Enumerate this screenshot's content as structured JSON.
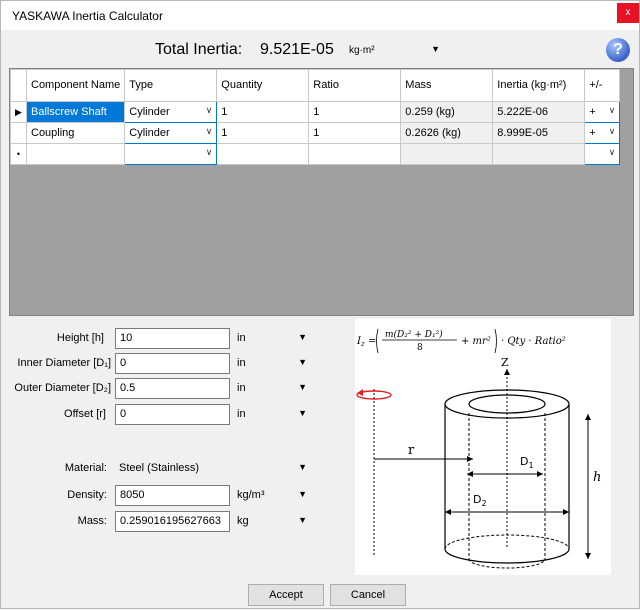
{
  "window": {
    "title": "YASKAWA Inertia Calculator",
    "close_glyph": "x"
  },
  "total": {
    "label": "Total Inertia:",
    "value": "9.521E-05",
    "unit": "kg·m²"
  },
  "grid": {
    "columns": [
      "Component Name",
      "Type",
      "Quantity",
      "Ratio",
      "Mass",
      "Inertia (kg·m²)",
      "+/-"
    ],
    "rows": [
      {
        "name": "Ballscrew Shaft",
        "type": "Cylinder",
        "quantity": "1",
        "ratio": "1",
        "mass": "0.259 (kg)",
        "inertia": "5.222E-06",
        "sign": "+"
      },
      {
        "name": "Coupling",
        "type": "Cylinder",
        "quantity": "1",
        "ratio": "1",
        "mass": "0.2626 (kg)",
        "inertia": "8.999E-05",
        "sign": "+"
      }
    ],
    "new_row_marker": "•",
    "current_row_marker": "▶"
  },
  "props": {
    "height": {
      "label": "Height [h]",
      "value": "10",
      "unit": "in"
    },
    "inner": {
      "label": "Inner Diameter [D₁]",
      "value": "0",
      "unit": "in"
    },
    "outer": {
      "label": "Outer Diameter [D₂]",
      "value": "0.5",
      "unit": "in"
    },
    "offset": {
      "label": "Offset [r]",
      "value": "0",
      "unit": "in"
    },
    "material": {
      "label": "Material:",
      "value": "Steel (Stainless)"
    },
    "density": {
      "label": "Density:",
      "value": "8050",
      "unit": "kg/m³"
    },
    "mass": {
      "label": "Mass:",
      "value": "0.259016195627663",
      "unit": "kg"
    }
  },
  "diagram": {
    "formula_lhs": "I",
    "formula_sub": "z",
    "formula_tail": "· Qty · Ratio²",
    "axis_label": "Z",
    "r_label": "r",
    "d1_label": "D",
    "d1_sub": "1",
    "d2_label": "D",
    "d2_sub": "2",
    "h_label": "h"
  },
  "buttons": {
    "accept": "Accept",
    "cancel": "Cancel"
  }
}
